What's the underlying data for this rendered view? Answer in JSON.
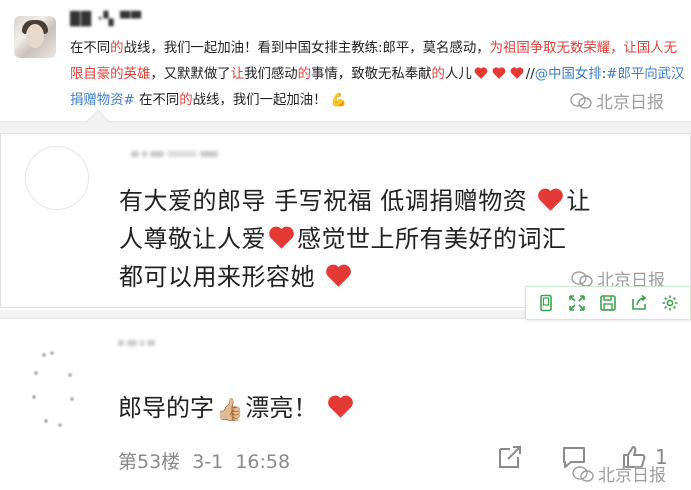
{
  "post": {
    "username": "██ ·▚ ▀▀",
    "seg1": "在不同",
    "seg2": "的",
    "seg3": "战线，我们一起加油！看到中国女排主教练:郎平，莫名感动，",
    "seg4": "为祖国争取无数荣耀，让国人无限自豪的英雄",
    "seg5": "，又默默做了",
    "seg6": "让",
    "seg7": "我们感动",
    "seg8": "的",
    "seg9": "事情，致敬无私奉献",
    "seg10": "的",
    "seg11": "人儿",
    "seg12": "//",
    "mention": "@中国女排",
    "seg13": ":",
    "hashtag": "#郎平向武汉捐赠物资#",
    "seg14": " 在不同",
    "seg15": "的",
    "seg16": "战线，我们一起加油！",
    "emoji_flex": "💪"
  },
  "comment1": {
    "line1": "有大爱的郎导 手写祝福 低调捐赠物资",
    "line1b": "让",
    "line2": "人尊敬让人爱",
    "line2b": "感觉世上所有美好的词汇",
    "line3": "都可以用来形容她"
  },
  "comment2": {
    "text1": "郎导的字",
    "thumb": "👍🏼",
    "text2": "漂亮！",
    "floor": "第53楼",
    "date": "3-1",
    "time": "16:58",
    "like_count": "1"
  },
  "watermark": {
    "label": "北京日报"
  },
  "toolbar": {
    "icons": [
      "phone-icon",
      "expand-icon",
      "save-icon",
      "share-icon",
      "settings-icon"
    ]
  },
  "colors": {
    "red": "#e0403c",
    "blue": "#3b7ec9",
    "heart": "#e53935",
    "toolbar_green": "#3aa34a",
    "gray": "#8a8a8a"
  }
}
